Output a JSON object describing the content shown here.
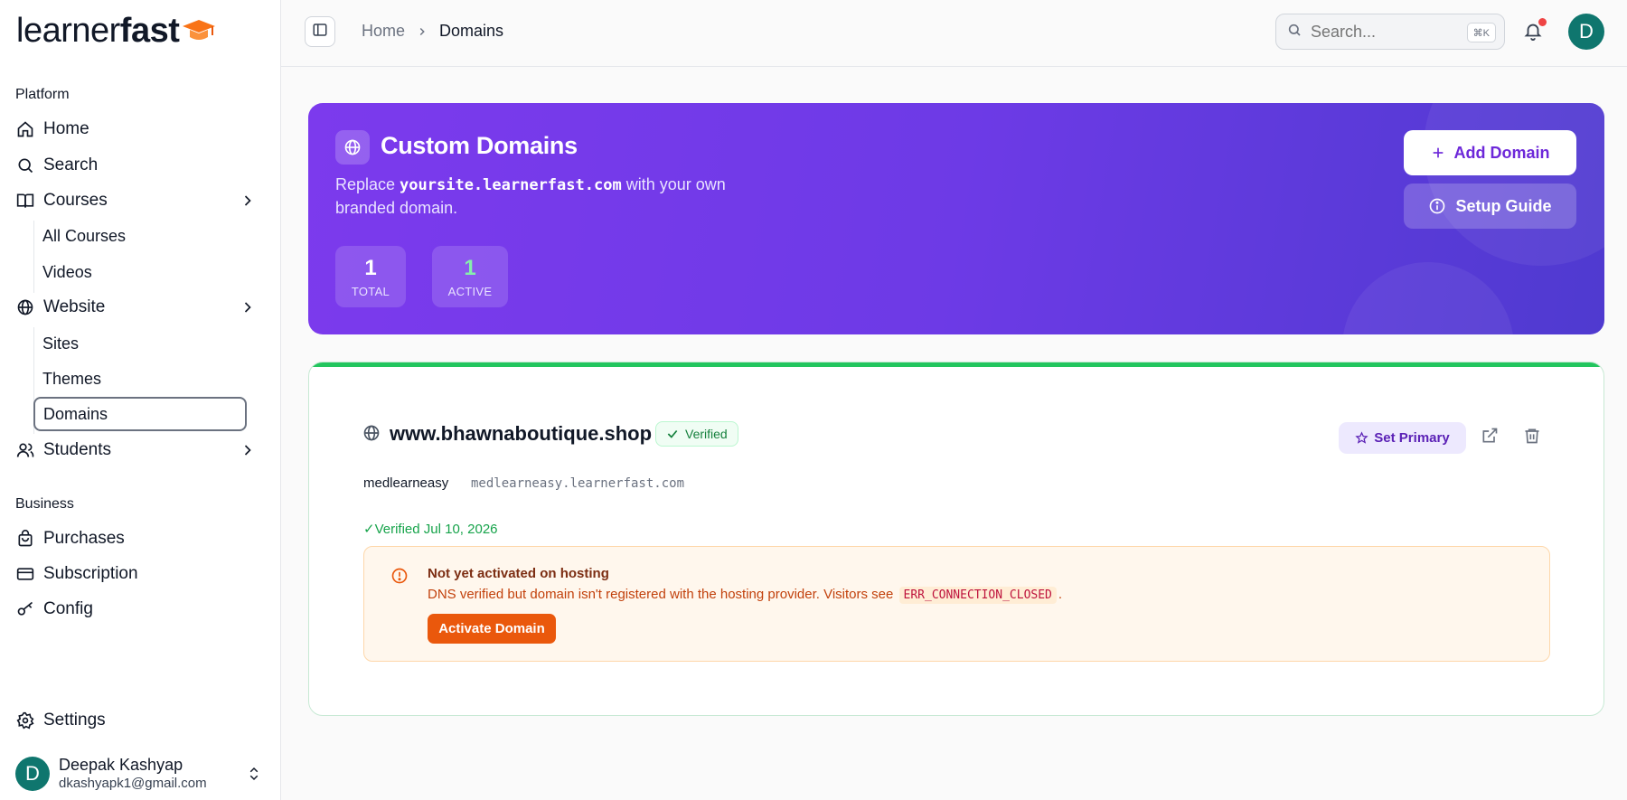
{
  "brand": {
    "name_light": "learner",
    "name_bold": "fast"
  },
  "sidebar": {
    "platform_label": "Platform",
    "business_label": "Business",
    "items": {
      "home": "Home",
      "search": "Search",
      "courses": "Courses",
      "all_courses": "All Courses",
      "videos": "Videos",
      "website": "Website",
      "sites": "Sites",
      "themes": "Themes",
      "domains": "Domains",
      "students": "Students",
      "purchases": "Purchases",
      "subscription": "Subscription",
      "config": "Config",
      "settings": "Settings"
    },
    "user": {
      "initial": "D",
      "name": "Deepak Kashyap",
      "email": "dkashyapk1@gmail.com"
    }
  },
  "header": {
    "breadcrumb": {
      "home": "Home",
      "current": "Domains"
    },
    "search_placeholder": "Search...",
    "search_shortcut": "⌘K",
    "avatar_initial": "D"
  },
  "hero": {
    "title": "Custom Domains",
    "desc_prefix": "Replace ",
    "desc_code": "yoursite.learnerfast.com",
    "desc_suffix": " with your own branded domain.",
    "stats": {
      "total_value": "1",
      "total_label": "TOTAL",
      "active_value": "1",
      "active_label": "ACTIVE"
    },
    "add_button": "Add Domain",
    "guide_button": "Setup Guide"
  },
  "domain": {
    "name": "www.bhawnaboutique.shop",
    "status": "Verified",
    "set_primary": "Set Primary",
    "site_name": "medlearneasy",
    "site_subdomain": "medlearneasy.learnerfast.com",
    "verified_date": "✓Verified Jul 10, 2026",
    "warning": {
      "title": "Not yet activated on hosting",
      "text_prefix": "DNS verified but domain isn't registered with the hosting provider. Visitors see ",
      "code": "ERR_CONNECTION_CLOSED",
      "text_suffix": ".",
      "button": "Activate Domain"
    }
  },
  "colors": {
    "accent": "#7c3aed",
    "success": "#22c55e",
    "warning": "#ea580c",
    "avatar": "#0f766e"
  }
}
